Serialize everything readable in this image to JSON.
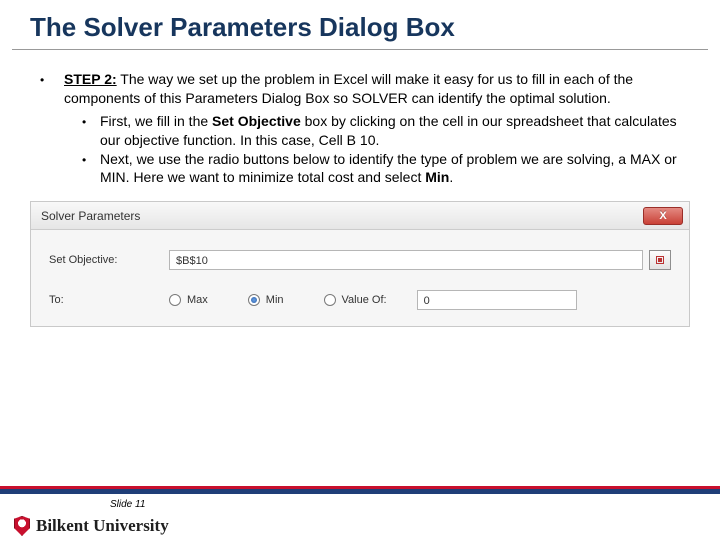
{
  "title": "The Solver Parameters Dialog Box",
  "step": {
    "label": "STEP 2:",
    "text": " The way we set up the problem in Excel will make it easy for us to fill in each of the components of this Parameters Dialog Box so SOLVER can identify the optimal solution."
  },
  "sub": [
    {
      "lead": "First, we fill in the ",
      "bold": "Set Objective",
      "tail": " box by clicking on the cell in our spreadsheet that calculates our objective function. In this case, Cell B 10."
    },
    {
      "lead": "Next, we use the radio buttons below to identify the type of problem we are solving, a MAX or MIN. Here we want to minimize total cost and select ",
      "bold": "Min",
      "tail": "."
    }
  ],
  "dialog": {
    "title": "Solver Parameters",
    "close": "X",
    "setObjectiveLabel": "Set Objective:",
    "objectiveValue": "$B$10",
    "toLabel": "To:",
    "options": {
      "max": "Max",
      "min": "Min",
      "valueOf": "Value Of:"
    },
    "selected": "min",
    "valueOfInput": "0"
  },
  "footer": {
    "slide": "Slide 11",
    "university": "Bilkent University"
  }
}
